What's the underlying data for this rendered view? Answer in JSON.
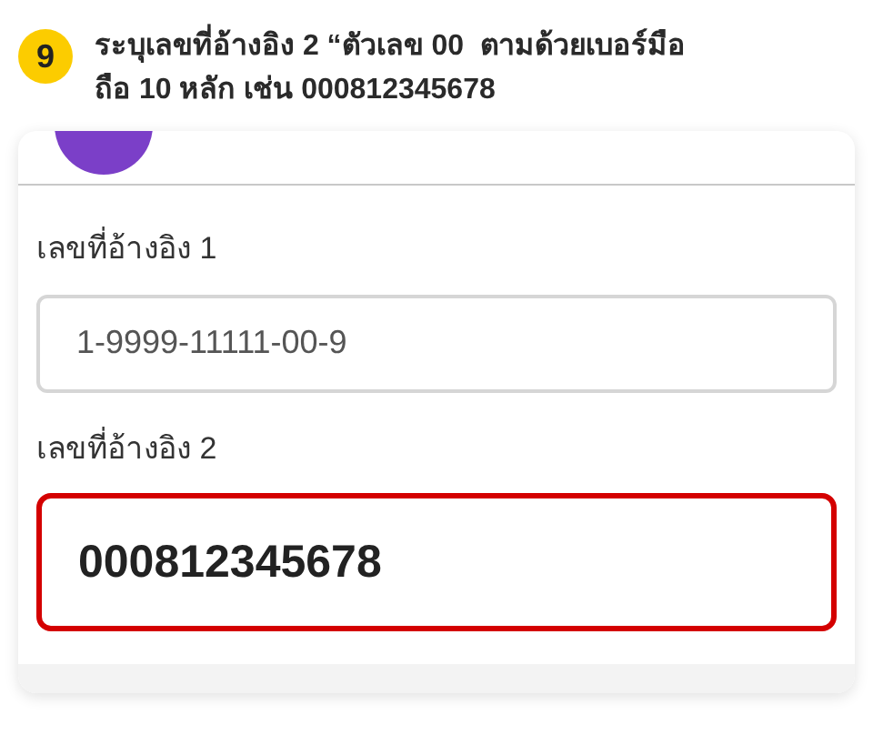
{
  "step": {
    "number": "9",
    "instruction": "ระบุเลขที่อ้างอิง 2 “ตัวเลข 00  ตามด้วยเบอร์มือถือ 10 หลัก เช่น 000812345678"
  },
  "fields": [
    {
      "label": "เลขที่อ้างอิง 1",
      "value": "1-9999-11111-00-9",
      "highlighted": false
    },
    {
      "label": "เลขที่อ้างอิง 2",
      "value": "000812345678",
      "highlighted": true
    }
  ]
}
